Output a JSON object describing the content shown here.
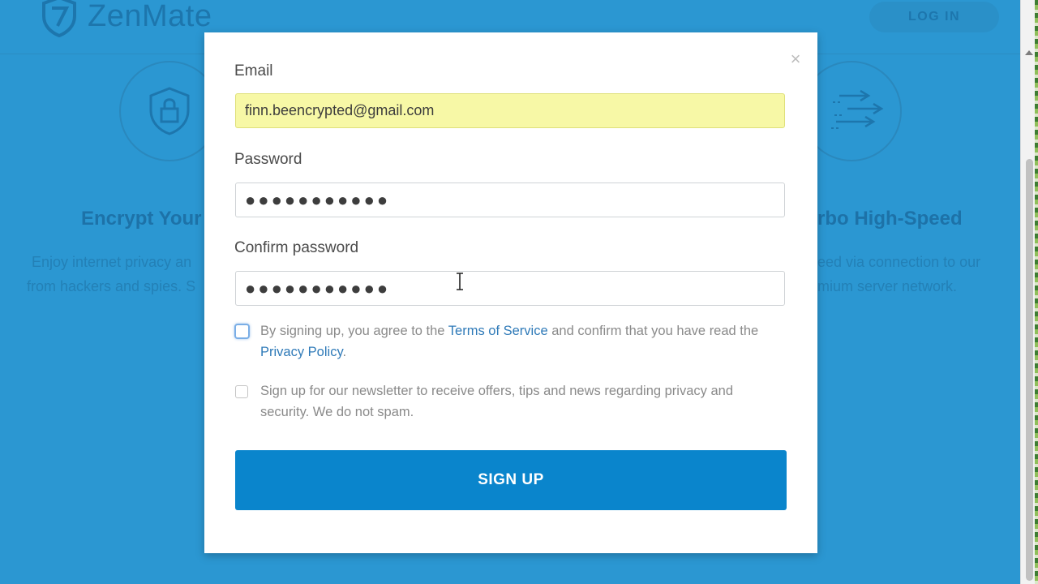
{
  "background": {
    "brand": "ZenMate",
    "login_label": "LOG IN",
    "feature_left": {
      "icon": "shield-lock-icon",
      "title": "Encrypt Your",
      "text_line1": "Enjoy internet privacy an",
      "text_line2": "from hackers and spies. S"
    },
    "feature_right": {
      "icon": "speed-arrows-icon",
      "title": "rbo High-Speed",
      "text_line1": "eed via connection to our",
      "text_line2": "mium server network."
    }
  },
  "modal": {
    "close_icon": "close-icon",
    "email": {
      "label": "Email",
      "value": "finn.beencrypted@gmail.com"
    },
    "password": {
      "label": "Password",
      "value": "●●●●●●●●●●●"
    },
    "confirm_password": {
      "label": "Confirm password",
      "value": "●●●●●●●●●●●"
    },
    "terms": {
      "prefix": "By signing up, you agree to the ",
      "tos_link": "Terms of Service",
      "middle": " and confirm that you have read the",
      "privacy_link": "Privacy Policy",
      "suffix": "."
    },
    "newsletter": {
      "text": "Sign up for our newsletter to receive offers, tips and news regarding privacy and security. We do not spam."
    },
    "signup_label": "SIGN UP"
  },
  "colors": {
    "background_blue": "#2b97d2",
    "button_blue": "#0a85cc",
    "link_blue": "#2f7ab8",
    "autofill_yellow": "#f7f8a6"
  }
}
